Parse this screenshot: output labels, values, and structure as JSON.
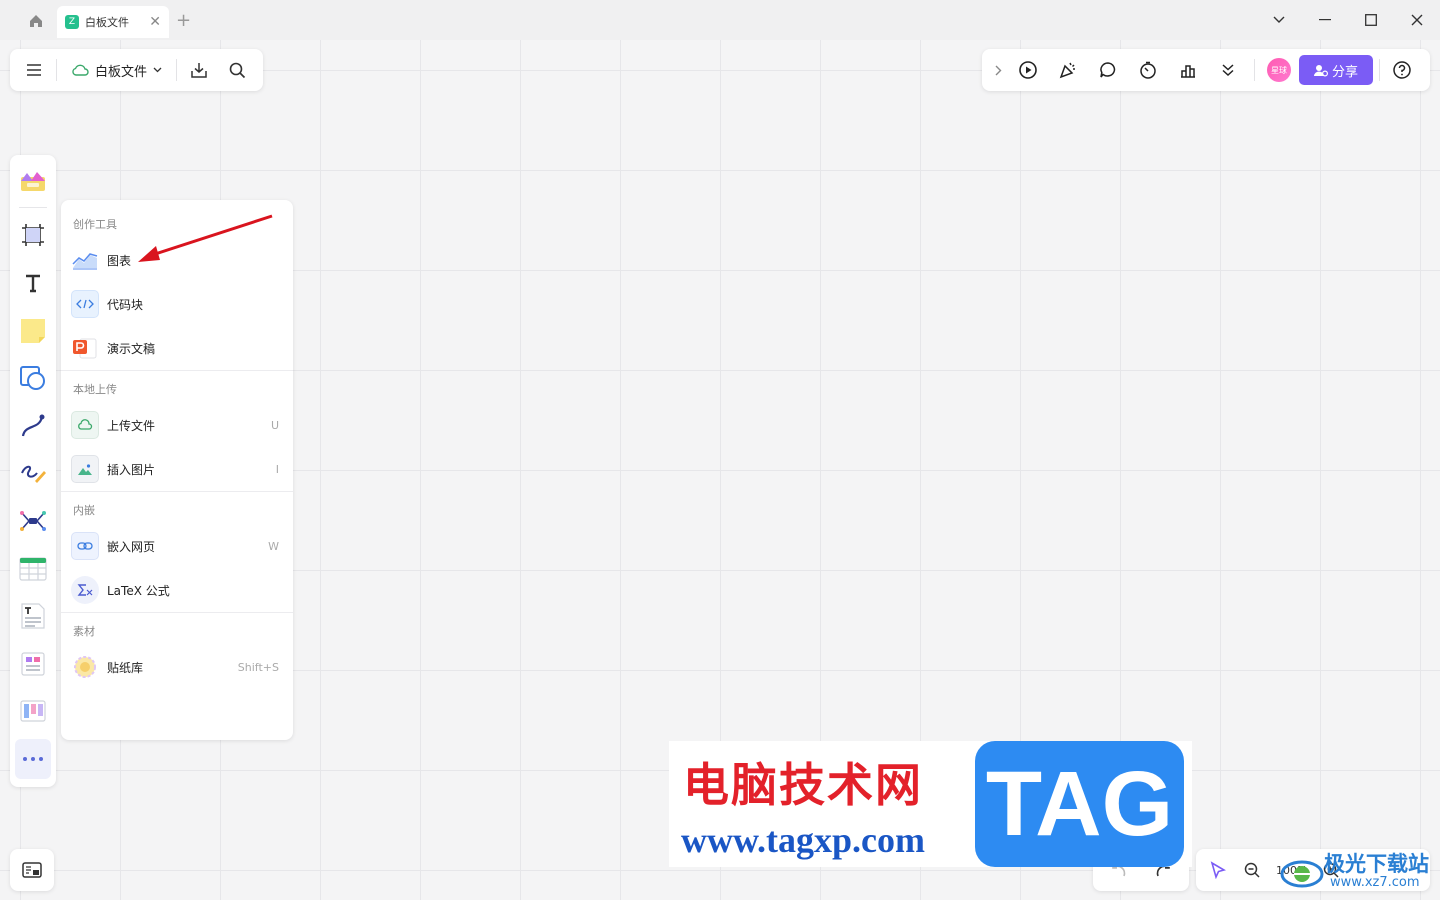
{
  "window": {
    "tab_title": "白板文件",
    "tab_logo": "Z",
    "new_tab": "+"
  },
  "header": {
    "doc_name": "白板文件"
  },
  "top_right": {
    "avatar_text": "星球",
    "share_label": "分享",
    "help_label": "?"
  },
  "menu": {
    "sections": [
      {
        "title": "创作工具",
        "items": [
          {
            "label": "图表",
            "key": ""
          },
          {
            "label": "代码块",
            "key": ""
          },
          {
            "label": "演示文稿",
            "key": ""
          }
        ]
      },
      {
        "title": "本地上传",
        "items": [
          {
            "label": "上传文件",
            "key": "U"
          },
          {
            "label": "插入图片",
            "key": "I"
          }
        ]
      },
      {
        "title": "内嵌",
        "items": [
          {
            "label": "嵌入网页",
            "key": "W"
          },
          {
            "label": "LaTeX 公式",
            "key": ""
          }
        ]
      },
      {
        "title": "素材",
        "items": [
          {
            "label": "贴纸库",
            "key": "Shift+S"
          }
        ]
      }
    ]
  },
  "zoom": {
    "value": "100%"
  },
  "watermark": {
    "title": "电脑技术网",
    "url": "www.tagxp.com",
    "tag": "TAG",
    "site_name": "极光下载站",
    "site_url": "www.xz7.com"
  },
  "colors": {
    "accent": "#7b5cf5",
    "brand_green": "#25c08e",
    "arrow": "#d9141e"
  },
  "icons": {
    "toolbar": [
      "templates-icon",
      "frame-icon",
      "text-icon",
      "sticky-note-icon",
      "shape-icon",
      "connector-icon",
      "pen-icon",
      "mindmap-icon",
      "table-icon",
      "document-icon",
      "kanban-icon",
      "board-icon",
      "more-icon"
    ]
  }
}
